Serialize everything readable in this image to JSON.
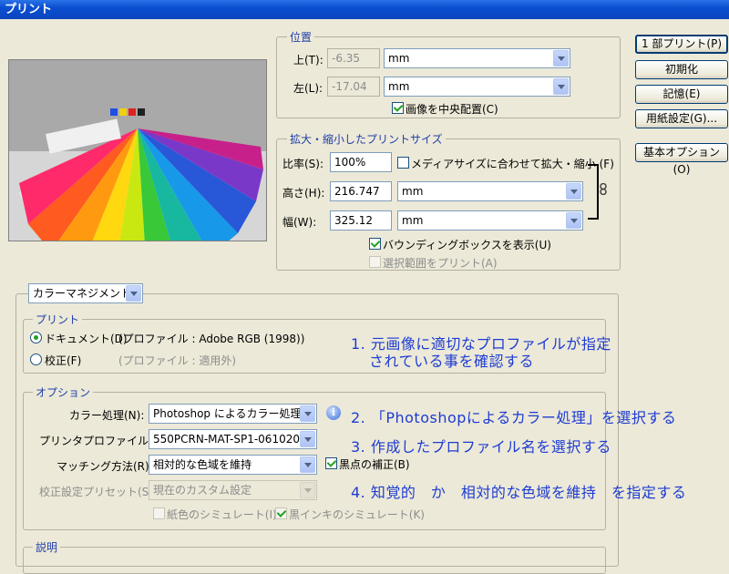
{
  "window": {
    "title": "プリント"
  },
  "buttons": {
    "print_one": "1 部プリント(P)",
    "reset": "初期化",
    "remember": "記憶(E)",
    "page_setup": "用紙設定(G)...",
    "basic_options": "基本オプション(O)"
  },
  "position": {
    "legend": "位置",
    "top_label": "上(T):",
    "top_value": "-6.35",
    "top_unit": "mm",
    "left_label": "左(L):",
    "left_value": "-17.04",
    "left_unit": "mm",
    "center_label": "画像を中央配置(C)"
  },
  "scaled": {
    "legend": "拡大・縮小したプリントサイズ",
    "scale_label": "比率(S):",
    "scale_value": "100%",
    "fit_media_label": "メディアサイズに合わせて拡大・縮小 (F)",
    "height_label": "高さ(H):",
    "height_value": "216.747",
    "height_unit": "mm",
    "width_label": "幅(W):",
    "width_value": "325.12",
    "width_unit": "mm",
    "bounding_box_label": "バウンディングボックスを表示(U)",
    "print_selection_label": "選択範囲をプリント(A)"
  },
  "color_mode": {
    "value": "カラーマネジメント"
  },
  "print_group": {
    "legend": "プリント",
    "document_label": "ドキュメント(D)",
    "document_profile": "(プロファイル : Adobe RGB (1998))",
    "proof_label": "校正(F)",
    "proof_profile": "(プロファイル : 適用外)"
  },
  "options": {
    "legend": "オプション",
    "color_handling_label": "カラー処理(N):",
    "color_handling_value": "Photoshop によるカラー処理",
    "printer_profile_label": "プリンタプロファイル(P):",
    "printer_profile_value": "550PCRN-MAT-SP1-061020",
    "rendering_label": "マッチング方法(R):",
    "rendering_value": "相対的な色域を維持",
    "black_point_label": "黒点の補正(B)",
    "proof_setup_label": "校正設定プリセット(S):",
    "proof_setup_value": "現在のカスタム設定",
    "simulate_paper_label": "紙色のシミュレート(I)",
    "simulate_ink_label": "黒インキのシミュレート(K)"
  },
  "description": {
    "legend": "説明"
  },
  "annotations": {
    "a1_line1": "1. 元画像に適切なプロファイルが指定",
    "a1_line2": "されている事を確認する",
    "a2": "2. 「Photoshopによるカラー処理」を選択する",
    "a3": "3. 作成したプロファイル名を選択する",
    "a4": "4. 知覚的　か　相対的な色域を維持　を指定する"
  }
}
